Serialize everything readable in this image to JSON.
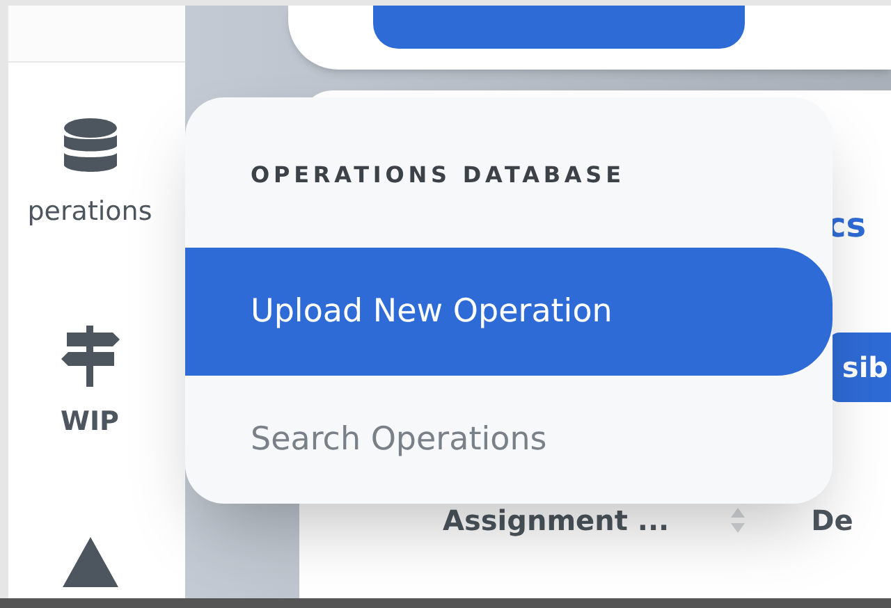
{
  "sidebar": {
    "items": [
      {
        "kind": "labeled",
        "label": "perations"
      },
      {
        "kind": "labeled",
        "label": "WIP"
      },
      {
        "kind": "icon"
      }
    ]
  },
  "menu": {
    "header": "OPERATIONS DATABASE",
    "items": [
      {
        "label": "Upload New Operation",
        "selected": true
      },
      {
        "label": "Search Operations",
        "selected": false
      }
    ]
  },
  "content": {
    "link_text": "cs",
    "button_text": "sib",
    "table": {
      "columns": [
        "Assignment ...",
        "De"
      ]
    }
  }
}
